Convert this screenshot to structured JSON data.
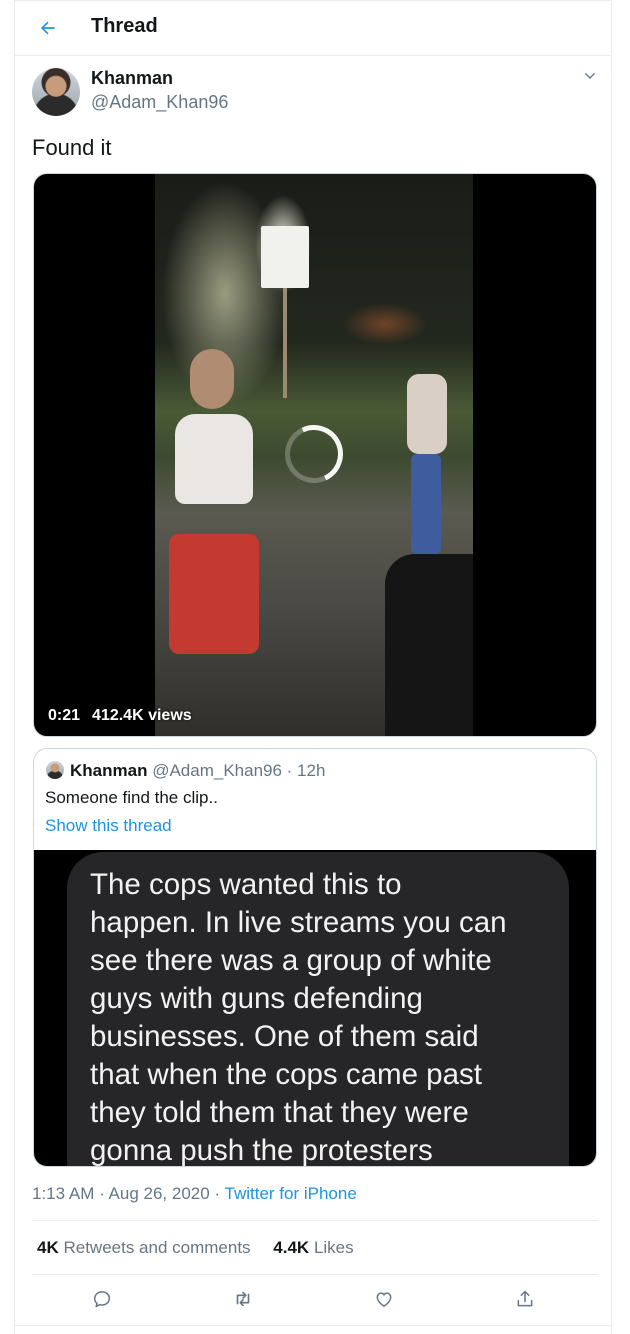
{
  "header": {
    "title": "Thread"
  },
  "tweet": {
    "author_name": "Khanman",
    "author_handle": "@Adam_Khan96",
    "text": "Found it",
    "video": {
      "duration": "0:21",
      "views": "412.4K views"
    },
    "timestamp": "1:13 AM · Aug 26, 2020 · ",
    "source": "Twitter for iPhone",
    "retweets_count": "4K",
    "retweets_label": "Retweets and comments",
    "likes_count": "4.4K",
    "likes_label": "Likes"
  },
  "quoted": {
    "author_name": "Khanman",
    "author_handle": "@Adam_Khan96",
    "time": "· 12h",
    "text": "Someone find the clip..",
    "show_thread": "Show this thread",
    "image_text": "The cops wanted this to\nhappen. In live streams you can\nsee there was a group of white\nguys with guns defending\nbusinesses. One of them said\nthat when the cops came past\nthey told them that they were\ngonna push the protesters"
  },
  "icons": {
    "back": "back-arrow-icon",
    "caret": "chevron-down-icon",
    "reply": "reply-icon",
    "retweet": "retweet-icon",
    "like": "heart-icon",
    "share": "share-icon"
  },
  "colors": {
    "accent": "#1b95e0",
    "muted": "#657786",
    "text": "#14171a"
  }
}
